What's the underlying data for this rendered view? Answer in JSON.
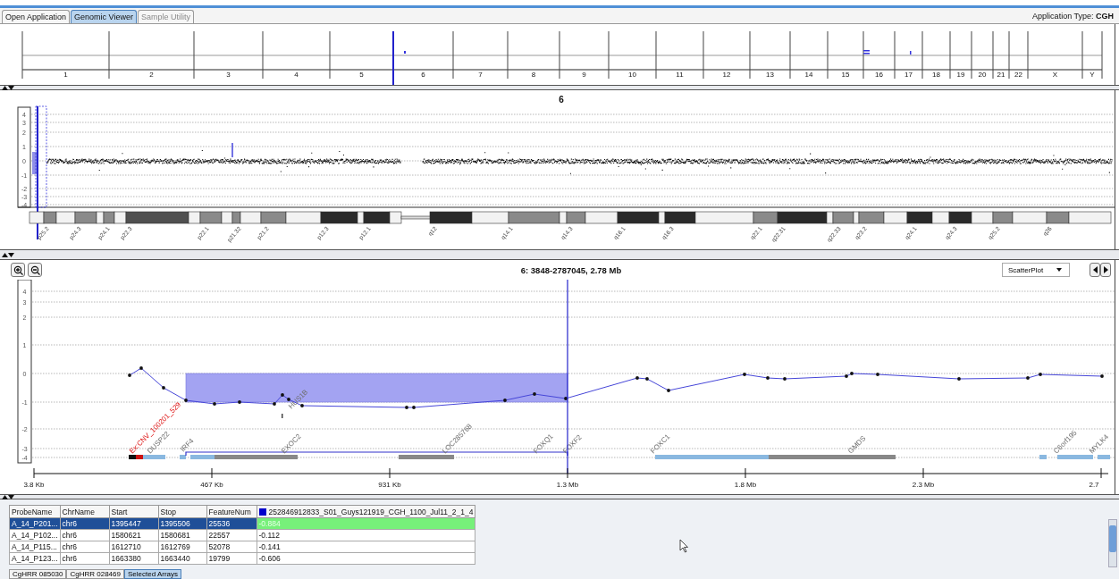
{
  "tabs": [
    {
      "label": "Open Application",
      "selected": false,
      "disabled": false
    },
    {
      "label": "Genomic Viewer",
      "selected": true,
      "disabled": false
    },
    {
      "label": "Sample Utility",
      "selected": false,
      "disabled": true
    }
  ],
  "application_type": "Application Type: **CGH**",
  "genome_overview": {
    "chromosomes": [
      {
        "label": "1",
        "selected": false
      },
      {
        "label": "2",
        "selected": false
      },
      {
        "label": "3",
        "selected": false
      },
      {
        "label": "4",
        "selected": false
      },
      {
        "label": "5",
        "selected": false
      },
      {
        "label": "6",
        "selected": true
      },
      {
        "label": "7",
        "selected": false
      },
      {
        "label": "8",
        "selected": false
      },
      {
        "label": "9",
        "selected": false
      },
      {
        "label": "10",
        "selected": false
      },
      {
        "label": "11",
        "selected": false
      },
      {
        "label": "12",
        "selected": false
      },
      {
        "label": "13",
        "selected": false
      },
      {
        "label": "14",
        "selected": false
      },
      {
        "label": "15",
        "selected": false
      },
      {
        "label": "16",
        "selected": false
      },
      {
        "label": "17",
        "selected": false
      },
      {
        "label": "18",
        "selected": false
      },
      {
        "label": "19",
        "selected": false
      },
      {
        "label": "20",
        "selected": false
      },
      {
        "label": "21",
        "selected": false
      },
      {
        "label": "22",
        "selected": false
      },
      {
        "label": "X",
        "selected": false
      },
      {
        "label": "Y",
        "selected": false
      }
    ]
  },
  "chromosome_view": {
    "title": "6",
    "y_ticks": [
      "4",
      "3",
      "2",
      "1",
      "0",
      "-1",
      "-2",
      "-3",
      "-4"
    ],
    "bands": [
      "p25.2",
      "p24.3",
      "p24.1",
      "p22.3",
      "p22.1",
      "p21.32",
      "p21.2",
      "p12.3",
      "p12.1",
      "q12",
      "q14.1",
      "q14.3",
      "q16.1",
      "q16.3",
      "q22.1",
      "q22.31",
      "q22.33",
      "q23.2",
      "q24.1",
      "q24.3",
      "q25.2",
      "q26"
    ]
  },
  "detail_view": {
    "title": "6: 3848-2787045, 2.78 Mb",
    "plot_type": "ScatterPlot",
    "y_ticks": [
      "4",
      "3",
      "2",
      "1",
      "0",
      "-1",
      "-2",
      "-3",
      "-4"
    ],
    "genes": [
      {
        "label": "Ex:CNV_100201_529",
        "kind": "cnv"
      },
      {
        "label": "DUSP22",
        "kind": "gene"
      },
      {
        "label": "IRF4",
        "kind": "gene"
      },
      {
        "label": "EXOC2",
        "kind": "gene"
      },
      {
        "label": "HUS1B",
        "kind": "gene"
      },
      {
        "label": "LOC285768",
        "kind": "gene"
      },
      {
        "label": "FOXQ1",
        "kind": "gene"
      },
      {
        "label": "FOXF2",
        "kind": "gene"
      },
      {
        "label": "FOXC1",
        "kind": "gene"
      },
      {
        "label": "GMDS",
        "kind": "gene"
      },
      {
        "label": "C6orf195",
        "kind": "gene"
      },
      {
        "label": "MYLK4",
        "kind": "gene"
      }
    ],
    "x_axis": [
      "3.8 Kb",
      "467 Kb",
      "931 Kb",
      "1.3 Mb",
      "1.8 Mb",
      "2.3 Mb",
      "2.7"
    ]
  },
  "table": {
    "columns": [
      {
        "label": "ProbeName"
      },
      {
        "label": "ChrName"
      },
      {
        "label": "Start"
      },
      {
        "label": "Stop"
      },
      {
        "label": "FeatureNum"
      },
      {
        "label": "252846912833_S01_Guys121919_CGH_1100_Jul11_2_1_4",
        "color": "#0000cc"
      }
    ],
    "rows": [
      {
        "cells": [
          "A_14_P201...",
          "chr6",
          "1395447",
          "1395506",
          "25536",
          "-0.884"
        ],
        "selected": true
      },
      {
        "cells": [
          "A_14_P102...",
          "chr6",
          "1580621",
          "1580681",
          "22557",
          "-0.112"
        ],
        "selected": false
      },
      {
        "cells": [
          "A_14_P115...",
          "chr6",
          "1612710",
          "1612769",
          "52078",
          "-0.141"
        ],
        "selected": false
      },
      {
        "cells": [
          "A_14_P123...",
          "chr6",
          "1663380",
          "1663440",
          "19799",
          "-0.606"
        ],
        "selected": false
      }
    ]
  },
  "bottom_tabs": [
    {
      "label": "CgHRR 085030",
      "selected": false
    },
    {
      "label": "CgHRR 028469",
      "selected": false
    },
    {
      "label": "Selected Arrays",
      "selected": true
    }
  ]
}
